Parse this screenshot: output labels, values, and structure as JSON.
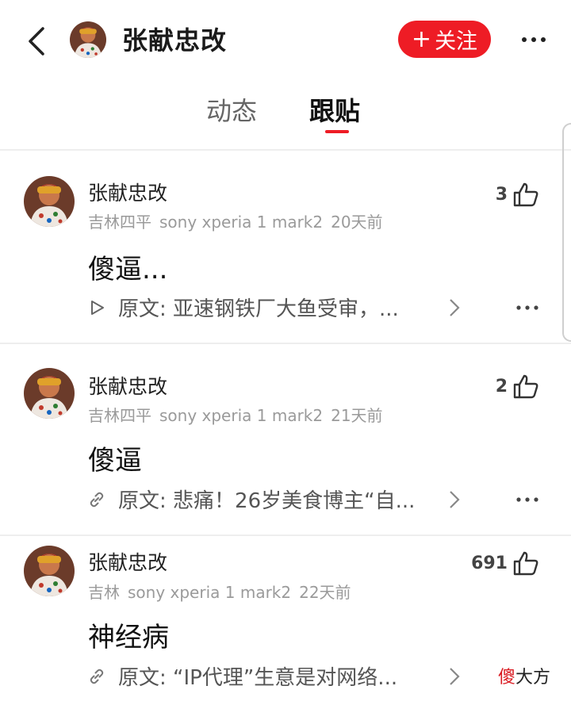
{
  "header": {
    "title": "张献忠改",
    "follow_label": "关注",
    "follow_plus": "+"
  },
  "tabs": [
    {
      "label": "动态",
      "active": false
    },
    {
      "label": "跟贴",
      "active": true
    }
  ],
  "posts": [
    {
      "author": "张献忠改",
      "location": "吉林四平",
      "device": "sony xperia 1 mark2",
      "time": "20天前",
      "likes": "3",
      "content": "傻逼...",
      "original_icon": "play-icon",
      "original": "原文: 亚速钢铁厂大鱼受审，..."
    },
    {
      "author": "张献忠改",
      "location": "吉林四平",
      "device": "sony xperia 1 mark2",
      "time": "21天前",
      "likes": "2",
      "content": "傻逼",
      "original_icon": "link-icon",
      "original": "原文: 悲痛！26岁美食博主“自..."
    },
    {
      "author": "张献忠改",
      "location": "吉林",
      "device": "sony xperia 1 mark2",
      "time": "22天前",
      "likes": "691",
      "content": "神经病",
      "original_icon": "link-icon",
      "original": "原文: “IP代理”生意是对网络..."
    }
  ],
  "watermark": {
    "part1": "傻",
    "part2": "大方"
  },
  "colors": {
    "accent": "#ee1c25",
    "meta": "#9a9a9a"
  }
}
